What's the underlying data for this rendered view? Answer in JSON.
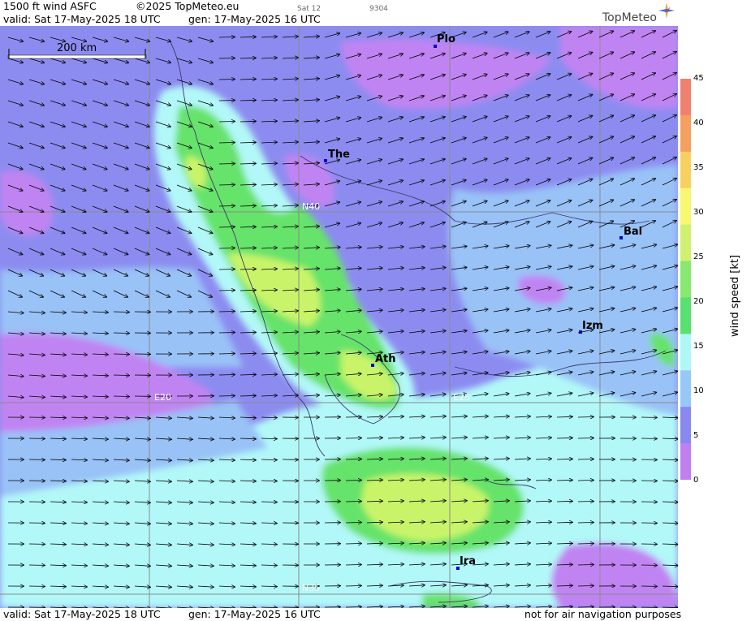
{
  "header": {
    "product": "1500 ft wind ASFC",
    "copyright": "©2025 TopMeteo.eu",
    "valid": "valid:  Sat  17-May-2025  18 UTC",
    "gen": "gen: 17-May-2025 16 UTC",
    "run_label": "Sat 12",
    "code": "9304",
    "logo_text": "TopMeteo"
  },
  "footer": {
    "valid": "valid:  Sat  17-May-2025  18 UTC",
    "gen": "gen: 17-May-2025 16 UTC",
    "disclaimer": "not for air navigation purposes"
  },
  "scale_bar": {
    "label": "200 km"
  },
  "graticule": {
    "lat_labels": [
      "N40",
      "N35"
    ],
    "lon_labels": [
      "E20",
      "E25"
    ]
  },
  "cities": [
    {
      "name": "Plo"
    },
    {
      "name": "The"
    },
    {
      "name": "Bal"
    },
    {
      "name": "Izm"
    },
    {
      "name": "Ath"
    },
    {
      "name": "Ira"
    }
  ],
  "colorbar": {
    "title": "wind  speed  [kt]",
    "ticks": [
      "45",
      "40",
      "35",
      "30",
      "25",
      "20",
      "15",
      "10",
      "5",
      "0"
    ],
    "colors": [
      "#f08070",
      "#f5a060",
      "#f8d060",
      "#f8f870",
      "#d0f070",
      "#88e870",
      "#58e070",
      "#b0f8f8",
      "#98c8f8",
      "#8888f0",
      "#c080f0"
    ]
  },
  "colors": {
    "calm_purple": "#c084f2",
    "light_purple": "#8c8cf0",
    "blue": "#99c2f7",
    "cyan": "#b2f8f8",
    "green": "#66e36a",
    "lime": "#c9f46a",
    "city_marker": "#0000cc"
  }
}
